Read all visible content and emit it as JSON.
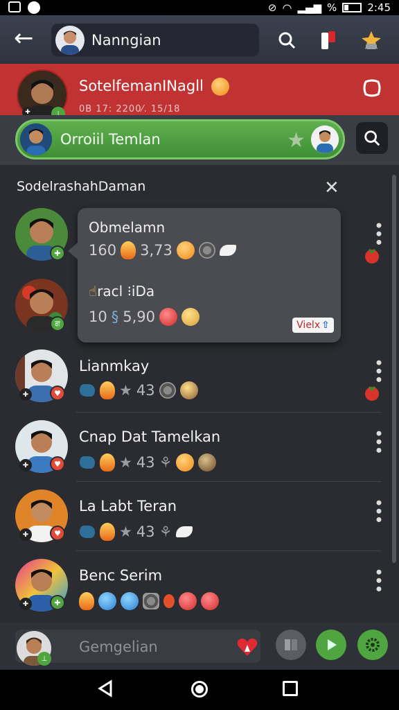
{
  "status_bar": {
    "battery_text": "%",
    "time": "2:45"
  },
  "header": {
    "title": "Nanngian"
  },
  "notification": {
    "title": "SotelfemanINagll",
    "subtitle": "0B 17: 2200⁄. 15/18"
  },
  "search": {
    "label": "Orroiil Temlan"
  },
  "panel": {
    "title": "SodelrashahDaman",
    "bubble": {
      "title_1": "Obmelamn",
      "count_1": "160",
      "value_1": "3,73",
      "title_2": "racl ⁝iDa",
      "count_2": "10",
      "value_2": "5,90",
      "button_label": "Vielx"
    },
    "rows": [
      {
        "name": "Lianmkay",
        "count": "43"
      },
      {
        "name": "Cnap Dat Tamelkan",
        "count": "43"
      },
      {
        "name": "La Labt Teran",
        "count": "43"
      },
      {
        "name": "Benc Serim",
        "count": ""
      }
    ]
  },
  "composer": {
    "placeholder": "Gemgelian"
  },
  "colors": {
    "accent_red": "#c13233",
    "accent_green": "#4fa640",
    "background": "#2a2c31"
  }
}
